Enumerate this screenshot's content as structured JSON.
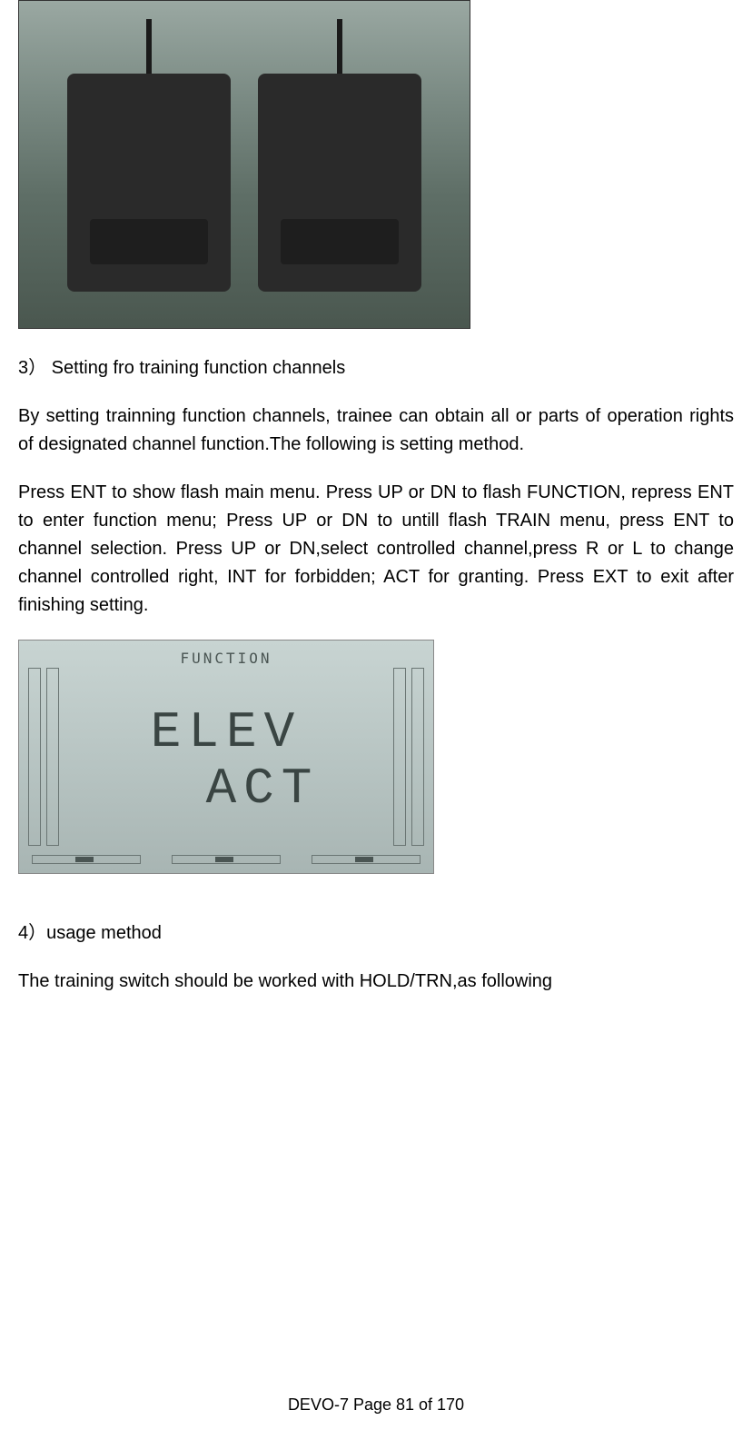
{
  "figure1": {
    "alt": "Two RC transmitters shown from behind with antennas"
  },
  "section3": {
    "heading": "3）  Setting fro training function channels",
    "para1": "By setting trainning function channels, trainee can obtain all or parts of operation rights of designated channel function.The following is setting method.",
    "para2": "Press ENT to show flash main menu. Press UP or DN to flash FUNCTION, repress ENT to enter function menu; Press UP or DN to untill flash TRAIN menu, press ENT to channel selection. Press UP or DN,select controlled channel,press R or L to change channel controlled right, INT for forbidden; ACT for granting. Press EXT to exit after finishing setting."
  },
  "figure2": {
    "top_label": "FUNCTION",
    "line1": "ELEV",
    "line2": "ACT"
  },
  "section4": {
    "heading": "4）usage method",
    "para1": "The training switch should be worked with HOLD/TRN,as following"
  },
  "footer": {
    "text": "DEVO-7   Page 81 of 170"
  }
}
